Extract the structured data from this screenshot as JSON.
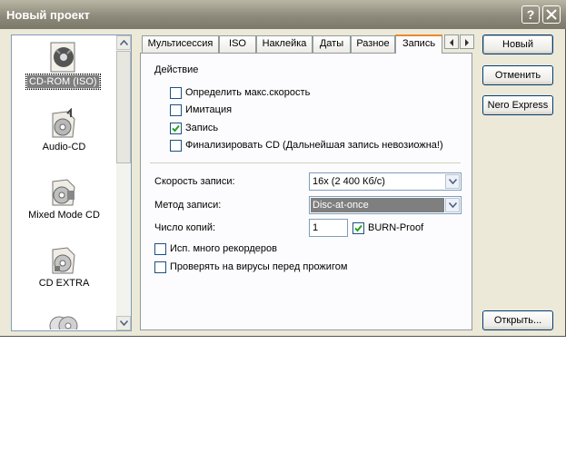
{
  "window": {
    "title": "Новый проект",
    "help_glyph": "?"
  },
  "categories": [
    {
      "label": "CD-ROM (ISO)",
      "icon": "cd-rom-icon",
      "selected": true
    },
    {
      "label": "Audio-CD",
      "icon": "audio-cd-icon",
      "selected": false
    },
    {
      "label": "Mixed Mode CD",
      "icon": "mixed-mode-cd-icon",
      "selected": false
    },
    {
      "label": "CD EXTRA",
      "icon": "cd-extra-icon",
      "selected": false
    }
  ],
  "tabs": [
    {
      "label": "Мультисессия",
      "active": false
    },
    {
      "label": "ISO",
      "active": false
    },
    {
      "label": "Наклейка",
      "active": false
    },
    {
      "label": "Даты",
      "active": false
    },
    {
      "label": "Разное",
      "active": false
    },
    {
      "label": "Запись",
      "active": true
    }
  ],
  "action": {
    "label": "Действие",
    "options": [
      {
        "label": "Определить макс.скорость",
        "checked": false
      },
      {
        "label": "Имитация",
        "checked": false
      },
      {
        "label": "Запись",
        "checked": true
      },
      {
        "label": "Финализировать CD (Дальнейшая запись невозиожна!)",
        "checked": false
      }
    ]
  },
  "fields": {
    "speed_label": "Скорость записи:",
    "speed_value": "16x (2 400 Кб/с)",
    "method_label": "Метод записи:",
    "method_value": "Disc-at-once",
    "copies_label": "Число копий:",
    "copies_value": "1",
    "burnproof_label": "BURN-Proof",
    "burnproof_checked": true
  },
  "extra_options": [
    {
      "label": "Исп. много рекордеров",
      "checked": false
    },
    {
      "label": "Проверять на вирусы перед прожигом",
      "checked": false
    }
  ],
  "buttons": {
    "new": "Новый",
    "cancel": "Отменить",
    "nero_express": "Nero Express",
    "open": "Открыть..."
  }
}
